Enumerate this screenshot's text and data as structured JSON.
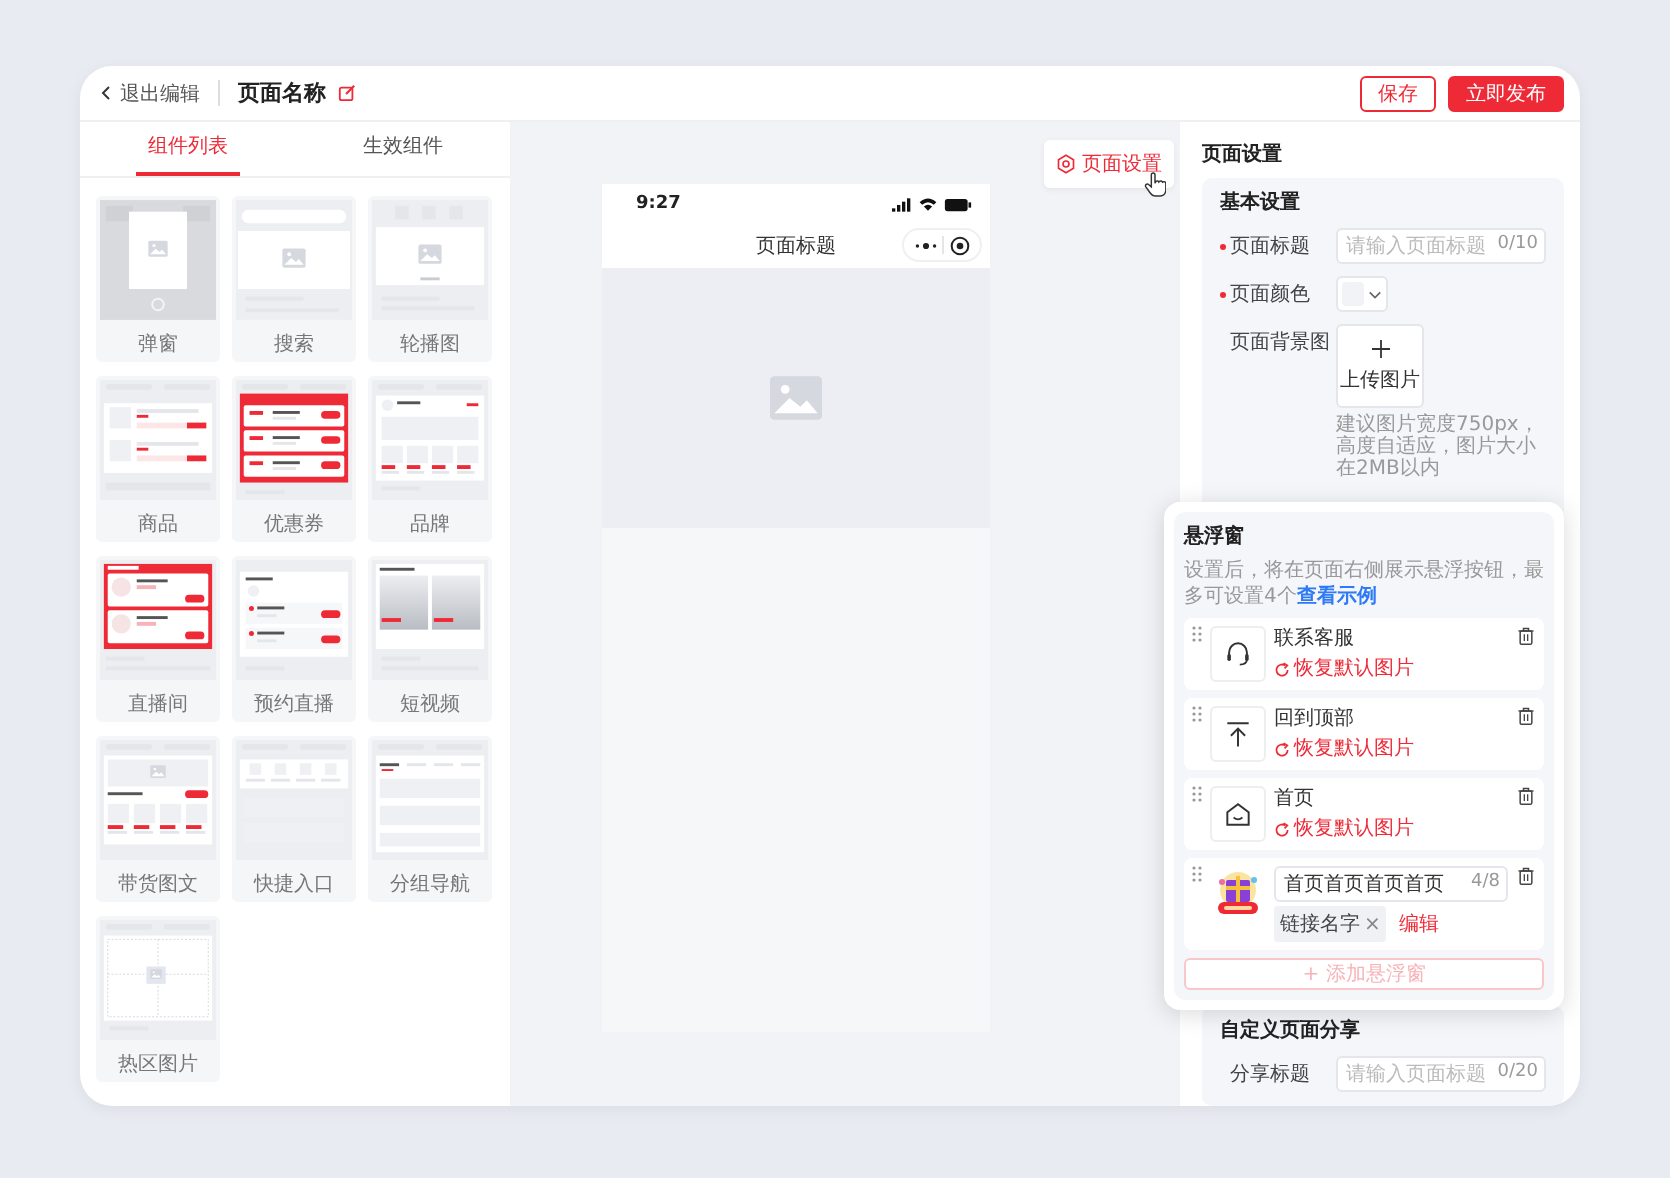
{
  "header": {
    "back": "退出编辑",
    "page_name": "页面名称",
    "buttons": [
      {
        "label": "保存",
        "kind": "outline"
      },
      {
        "label": "立即发布",
        "kind": "primary"
      }
    ]
  },
  "component_tabs": [
    {
      "label": "组件列表",
      "selected": true
    },
    {
      "label": "生效组件",
      "selected": false
    }
  ],
  "components": [
    {
      "label": "弹窗",
      "kind": "popup"
    },
    {
      "label": "搜索",
      "kind": "search"
    },
    {
      "label": "轮播图",
      "kind": "banner"
    },
    {
      "label": "商品",
      "kind": "goods"
    },
    {
      "label": "优惠券",
      "kind": "coupon"
    },
    {
      "label": "品牌",
      "kind": "brand"
    },
    {
      "label": "直播间",
      "kind": "live"
    },
    {
      "label": "预约直播",
      "kind": "reserve"
    },
    {
      "label": "短视频",
      "kind": "video"
    },
    {
      "label": "带货图文",
      "kind": "article"
    },
    {
      "label": "快捷入口",
      "kind": "shortcut"
    },
    {
      "label": "分组导航",
      "kind": "tabs"
    },
    {
      "label": "热区图片",
      "kind": "hotspot"
    }
  ],
  "preview": {
    "settings_button": "页面设置",
    "time": "9:27",
    "title": "页面标题"
  },
  "settings": {
    "title": "页面设置",
    "basic": {
      "heading": "基本设置",
      "fields": [
        {
          "kind": "text",
          "label": "页面标题",
          "required": true,
          "placeholder": "请输入页面标题",
          "count": "0/10"
        },
        {
          "kind": "color",
          "label": "页面颜色",
          "required": true
        },
        {
          "kind": "upload",
          "label": "页面背景图",
          "required": false,
          "button": "上传图片",
          "hint": "建议图片宽度750px，高度自适应，图片大小在2MB以内"
        }
      ]
    },
    "share": {
      "heading": "自定义页面分享",
      "fields": [
        {
          "kind": "text",
          "label": "分享标题",
          "required": false,
          "placeholder": "请输入页面标题",
          "count": "0/20"
        }
      ]
    }
  },
  "float_panel": {
    "title": "悬浮窗",
    "description": "设置后，将在页面右侧展示悬浮按钮，最多可设置4个",
    "link": "查看示例",
    "items": [
      {
        "kind": "service",
        "name": "联系客服",
        "reset": "恢复默认图片"
      },
      {
        "kind": "top",
        "name": "回到顶部",
        "reset": "恢复默认图片"
      },
      {
        "kind": "home",
        "name": "首页",
        "reset": "恢复默认图片"
      },
      {
        "kind": "custom",
        "value": "首页首页首页首页",
        "count": "4/8",
        "tag": "链接名字",
        "tag_close": "×",
        "edit": "编辑"
      }
    ],
    "add_button": {
      "label": "+ 添加悬浮窗",
      "disabled": true
    }
  }
}
